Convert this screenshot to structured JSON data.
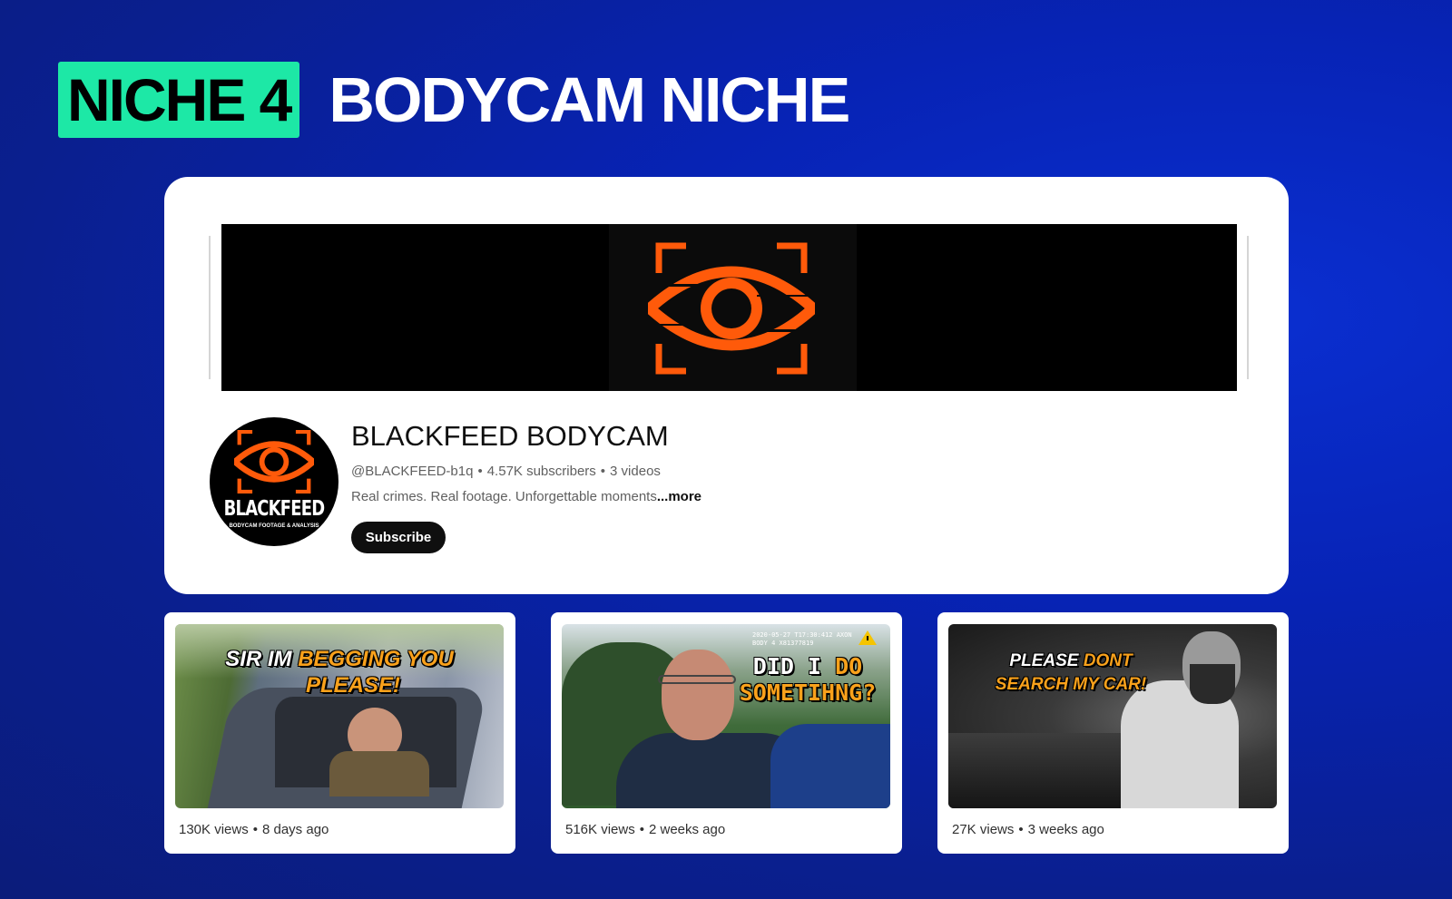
{
  "header": {
    "badge": "NICHE 4",
    "title": "BODYCAM NICHE"
  },
  "colors": {
    "accent": "#1de8a6",
    "background": "#0723b5",
    "banner_logo": "#ff5a0a",
    "highlight": "#f9a11b"
  },
  "channel": {
    "name": "BLACKFEED BODYCAM",
    "handle": "@BLACKFEED-b1q",
    "subscribers": "4.57K subscribers",
    "videos": "3 videos",
    "description": "Real crimes. Real footage. Unforgettable moments",
    "more": "...more",
    "subscribe_label": "Subscribe",
    "avatar_name": "BLACKFEED",
    "avatar_tagline": "BODYCAM FOOTAGE & ANALYSIS"
  },
  "videos": [
    {
      "line1_w": "SIR IM ",
      "line1_y": "BEGGING YOU",
      "line2_y": "PLEASE!",
      "views": "130K views",
      "age": "8 days ago"
    },
    {
      "line1_w": "DID I ",
      "line1_y": "DO",
      "line2_y": "SOMETIHNG?",
      "overlay": "2020-05-27 T17:30:412  AXON BODY 4 X81377819",
      "views": "516K views",
      "age": "2 weeks ago"
    },
    {
      "line1_w": "PLEASE ",
      "line1_y": "DONT",
      "line2_y": "SEARCH MY CAR!",
      "views": "27K views",
      "age": "3 weeks ago"
    }
  ],
  "icons": [
    "eye-logo-icon",
    "warning-triangle-icon"
  ]
}
